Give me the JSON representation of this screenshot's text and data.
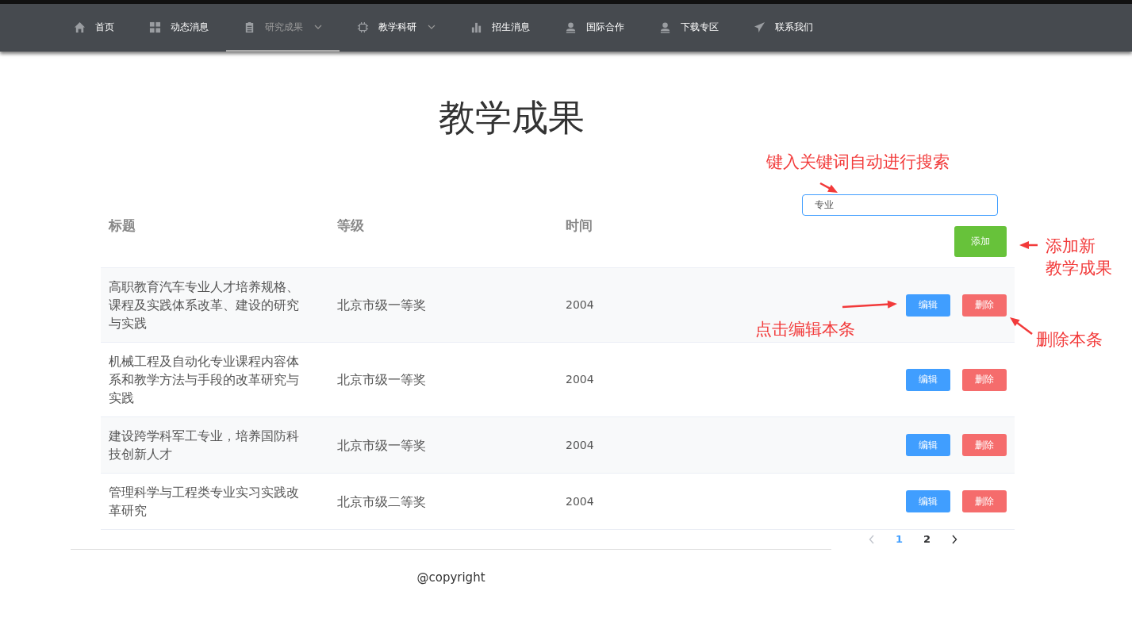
{
  "nav": [
    {
      "label": "首页",
      "kind": "home",
      "selected": false,
      "dropdown": false
    },
    {
      "label": "动态消息",
      "kind": "grid",
      "selected": false,
      "dropdown": false
    },
    {
      "label": "研究成果",
      "kind": "clipboard",
      "selected": true,
      "dropdown": true
    },
    {
      "label": "教学科研",
      "kind": "chip",
      "selected": false,
      "dropdown": true
    },
    {
      "label": "招生消息",
      "kind": "chart",
      "selected": false,
      "dropdown": false
    },
    {
      "label": "国际合作",
      "kind": "person",
      "selected": false,
      "dropdown": false
    },
    {
      "label": "下载专区",
      "kind": "person",
      "selected": false,
      "dropdown": false
    },
    {
      "label": "联系我们",
      "kind": "plane",
      "selected": false,
      "dropdown": false
    }
  ],
  "page_title": "教学成果",
  "table": {
    "columns": [
      "标题",
      "等级",
      "时间"
    ],
    "search": {
      "value": "专业"
    },
    "add_button": "添加",
    "rows": [
      {
        "title": "高职教育汽车专业人才培养规格、课程及实践体系改革、建设的研究与实践",
        "level": "北京市级一等奖",
        "year": "2004",
        "edit": "编辑",
        "delete": "删除"
      },
      {
        "title": "机械工程及自动化专业课程内容体系和教学方法与手段的改革研究与实践",
        "level": "北京市级一等奖",
        "year": "2004",
        "edit": "编辑",
        "delete": "删除"
      },
      {
        "title": "建设跨学科军工专业，培养国防科技创新人才",
        "level": "北京市级一等奖",
        "year": "2004",
        "edit": "编辑",
        "delete": "删除"
      },
      {
        "title": "管理科学与工程类专业实习实践改革研究",
        "level": "北京市级二等奖",
        "year": "2004",
        "edit": "编辑",
        "delete": "删除"
      }
    ]
  },
  "pagination": {
    "prev_disabled": true,
    "pages": [
      {
        "label": "1",
        "selected": true
      },
      {
        "label": "2",
        "selected": false
      }
    ],
    "next_disabled": false
  },
  "footer": "@copyright",
  "annotations": [
    {
      "lines": [
        "键入关键词自动进行搜索"
      ]
    },
    {
      "lines": [
        "添加新",
        "教学成果"
      ]
    },
    {
      "lines": [
        "点击编辑本条"
      ]
    },
    {
      "lines": [
        "删除本条"
      ]
    }
  ]
}
